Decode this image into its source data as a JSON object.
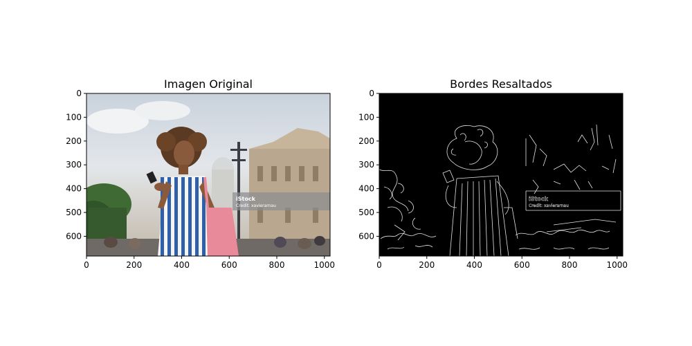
{
  "figure": {
    "panels": [
      {
        "title": "Imagen Original",
        "x_ticks": [
          "0",
          "200",
          "400",
          "600",
          "800",
          "1000"
        ],
        "y_ticks": [
          "0",
          "100",
          "200",
          "300",
          "400",
          "500",
          "600"
        ],
        "image_text": [
          "iStock",
          "Credit: xavierarnau"
        ],
        "style": "color photograph"
      },
      {
        "title": "Bordes Resaltados",
        "x_ticks": [
          "0",
          "200",
          "400",
          "600",
          "800",
          "1000"
        ],
        "y_ticks": [
          "0",
          "100",
          "200",
          "300",
          "400",
          "500",
          "600"
        ],
        "image_text": [
          "iStock",
          "Credit: xavierarnau"
        ],
        "style": "white edge lines on black"
      }
    ],
    "x_tick_values": [
      0,
      200,
      400,
      600,
      800,
      1000
    ],
    "y_tick_values": [
      0,
      100,
      200,
      300,
      400,
      500,
      600
    ],
    "image_width": 1024,
    "image_height": 683,
    "colors": {
      "sky": "#d9dde2",
      "dress_blue": "#2f5fa8",
      "bag_pink": "#e88a9a",
      "skin": "#8a5a3c",
      "edge_bg": "#000000",
      "edge_line": "#e6e6e6"
    }
  }
}
